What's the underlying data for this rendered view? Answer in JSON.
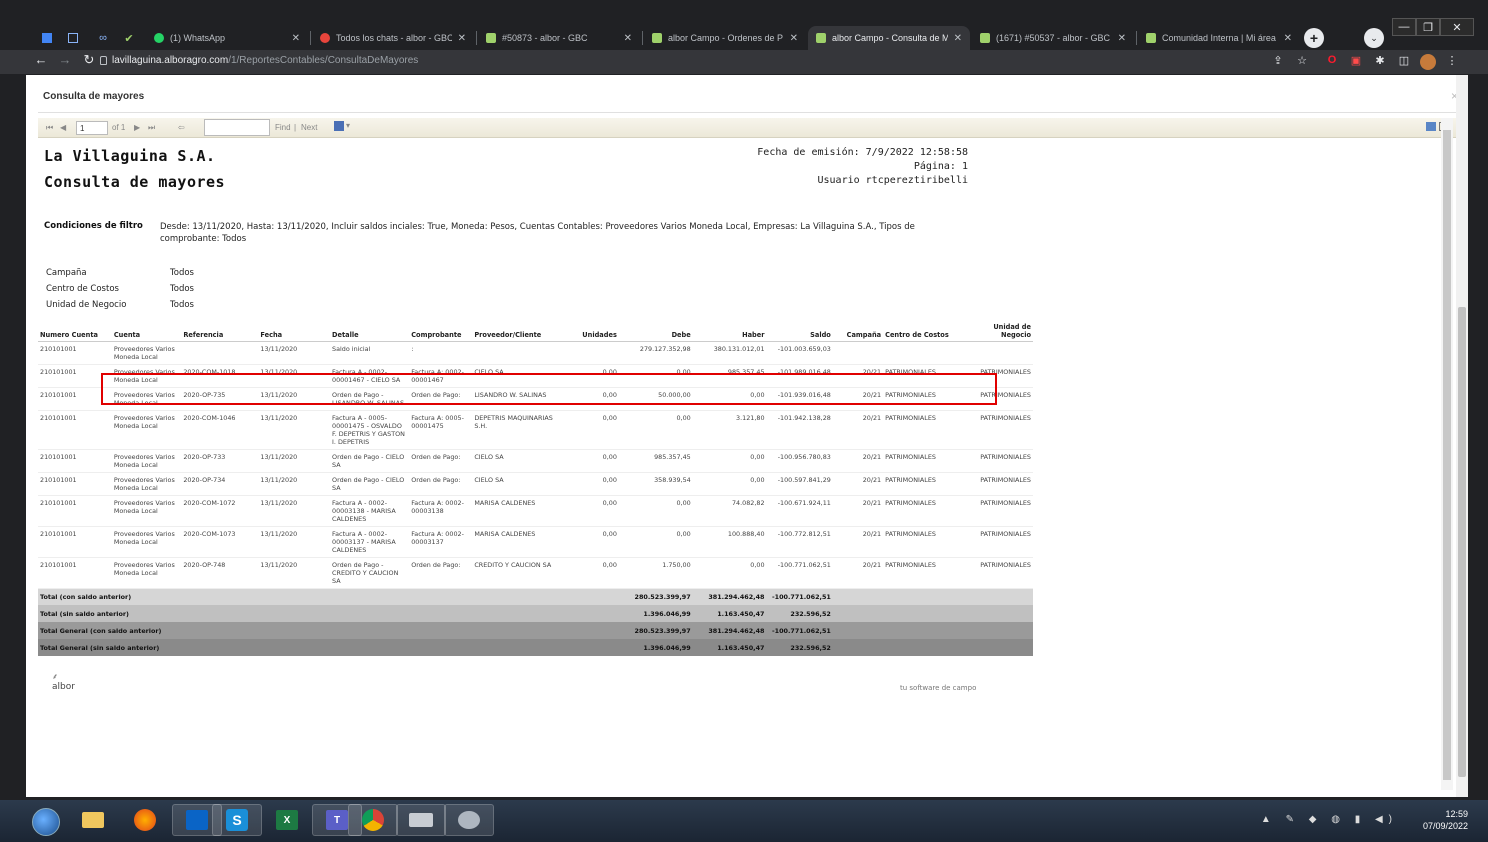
{
  "browser": {
    "tabs": [
      {
        "label": "(1) WhatsApp",
        "icon": "whatsapp-icon",
        "color": "#25d366"
      },
      {
        "label": "Todos los chats - albor - GBC",
        "icon": "chat-icon",
        "color": "#e8453c"
      },
      {
        "label": "#50873 - albor - GBC",
        "icon": "albor-icon",
        "color": "#9fd16b"
      },
      {
        "label": "albor Campo - Ordenes de P",
        "icon": "albor-icon",
        "color": "#9fd16b"
      },
      {
        "label": "albor Campo - Consulta de M",
        "icon": "albor-icon",
        "color": "#9fd16b"
      },
      {
        "label": "(1671) #50537 - albor - GBC",
        "icon": "albor-icon",
        "color": "#9fd16b"
      },
      {
        "label": "Comunidad Interna | Mi área",
        "icon": "albor-icon",
        "color": "#9fd16b"
      }
    ],
    "active_tab_index": 4,
    "url_host": "lavillaguina.alboragro.com",
    "url_path": "/1/ReportesContables/ConsultaDeMayores"
  },
  "dialog": {
    "title": "Consulta de mayores",
    "close": "×"
  },
  "viewer": {
    "page_value": "1",
    "of_pages": "of 1",
    "find_label": "Find",
    "next_label": "Next",
    "first": "⏮",
    "prev": "◀",
    "next": "▶",
    "last": "⏭",
    "back": "⇦"
  },
  "report": {
    "company": "La Villaguina S.A.",
    "title": "Consulta de mayores",
    "fecha_emision": "Fecha de emisión: 7/9/2022 12:58:58",
    "pagina": "Página: 1",
    "usuario": "Usuario rtcpereztiribelli",
    "filter_label": "Condiciones de filtro",
    "filter_value": "Desde: 13/11/2020, Hasta: 13/11/2020, Incluir saldos inciales: True, Moneda: Pesos, Cuentas Contables: Proveedores Varios Moneda Local, Empresas: La Villaguina S.A., Tipos de comprobante: Todos",
    "extra_filters": [
      {
        "label": "Campaña",
        "value": "Todos"
      },
      {
        "label": "Centro de Costos",
        "value": "Todos"
      },
      {
        "label": "Unidad de Negocio",
        "value": "Todos"
      }
    ],
    "columns": [
      "Numero Cuenta",
      "Cuenta",
      "Referencia",
      "Fecha",
      "Detalle",
      "Comprobante",
      "Proveedor/Cliente",
      "Unidades",
      "Debe",
      "Haber",
      "Saldo",
      "Campaña",
      "Centro de Costos",
      "Unidad de Negocio"
    ],
    "rows": [
      [
        "210101001",
        "Proveedores Varios Moneda Local",
        "",
        "13/11/2020",
        "Saldo inicial",
        ":",
        "",
        "",
        "279.127.352,98",
        "380.131.012,01",
        "-101.003.659,03",
        "",
        "",
        ""
      ],
      [
        "210101001",
        "Proveedores Varios Moneda Local",
        "2020-COM-1018",
        "13/11/2020",
        "Factura A - 0002-00001467 - CIELO SA",
        "Factura A: 0002-00001467",
        "CIELO SA",
        "0,00",
        "0,00",
        "985.357,45",
        "-101.989.016,48",
        "20/21",
        "PATRIMONIALES",
        "PATRIMONIALES"
      ],
      [
        "210101001",
        "Proveedores Varios Moneda Local",
        "2020-OP-735",
        "13/11/2020",
        "Orden de Pago - LISANDRO W. SALINAS",
        "Orden de Pago:",
        "LISANDRO W. SALINAS",
        "0,00",
        "50.000,00",
        "0,00",
        "-101.939.016,48",
        "20/21",
        "PATRIMONIALES",
        "PATRIMONIALES"
      ],
      [
        "210101001",
        "Proveedores Varios Moneda Local",
        "2020-COM-1046",
        "13/11/2020",
        "Factura A - 0005-00001475 - OSVALDO F. DEPETRIS Y GASTON I. DEPETRIS",
        "Factura A: 0005-00001475",
        "DEPETRIS MAQUINARIAS S.H.",
        "0,00",
        "0,00",
        "3.121,80",
        "-101.942.138,28",
        "20/21",
        "PATRIMONIALES",
        "PATRIMONIALES"
      ],
      [
        "210101001",
        "Proveedores Varios Moneda Local",
        "2020-OP-733",
        "13/11/2020",
        "Orden de Pago - CIELO SA",
        "Orden de Pago:",
        "CIELO SA",
        "0,00",
        "985.357,45",
        "0,00",
        "-100.956.780,83",
        "20/21",
        "PATRIMONIALES",
        "PATRIMONIALES"
      ],
      [
        "210101001",
        "Proveedores Varios Moneda Local",
        "2020-OP-734",
        "13/11/2020",
        "Orden de Pago - CIELO SA",
        "Orden de Pago:",
        "CIELO SA",
        "0,00",
        "358.939,54",
        "0,00",
        "-100.597.841,29",
        "20/21",
        "PATRIMONIALES",
        "PATRIMONIALES"
      ],
      [
        "210101001",
        "Proveedores Varios Moneda Local",
        "2020-COM-1072",
        "13/11/2020",
        "Factura A - 0002-00003138 - MARISA CALDENES",
        "Factura A: 0002-00003138",
        "MARISA CALDENES",
        "0,00",
        "0,00",
        "74.082,82",
        "-100.671.924,11",
        "20/21",
        "PATRIMONIALES",
        "PATRIMONIALES"
      ],
      [
        "210101001",
        "Proveedores Varios Moneda Local",
        "2020-COM-1073",
        "13/11/2020",
        "Factura A - 0002-00003137 - MARISA CALDENES",
        "Factura A: 0002-00003137",
        "MARISA CALDENES",
        "0,00",
        "0,00",
        "100.888,40",
        "-100.772.812,51",
        "20/21",
        "PATRIMONIALES",
        "PATRIMONIALES"
      ],
      [
        "210101001",
        "Proveedores Varios Moneda Local",
        "2020-OP-748",
        "13/11/2020",
        "Orden de Pago - CREDITO Y CAUCION SA",
        "Orden de Pago:",
        "CREDITO Y CAUCION SA",
        "0,00",
        "1.750,00",
        "0,00",
        "-100.771.062,51",
        "20/21",
        "PATRIMONIALES",
        "PATRIMONIALES"
      ]
    ],
    "totals": [
      {
        "label": "Total (con saldo anterior)",
        "debe": "280.523.399,97",
        "haber": "381.294.462,48",
        "saldo": "-100.771.062,51"
      },
      {
        "label": "Total (sin saldo anterior)",
        "debe": "1.396.046,99",
        "haber": "1.163.450,47",
        "saldo": "232.596,52"
      },
      {
        "label": "Total General (con saldo anterior)",
        "debe": "280.523.399,97",
        "haber": "381.294.462,48",
        "saldo": "-100.771.062,51"
      },
      {
        "label": "Total General (sin saldo anterior)",
        "debe": "1.396.046,99",
        "haber": "1.163.450,47",
        "saldo": "232.596,52"
      }
    ],
    "footer_logo": "albor",
    "footer_tagline": "tu software de campo"
  },
  "taskbar": {
    "time": "12:59",
    "date": "07/09/2022",
    "apps": [
      "explorer",
      "firefox",
      "outlook",
      "sway",
      "excel",
      "teams",
      "chrome",
      "app8",
      "app9"
    ]
  }
}
